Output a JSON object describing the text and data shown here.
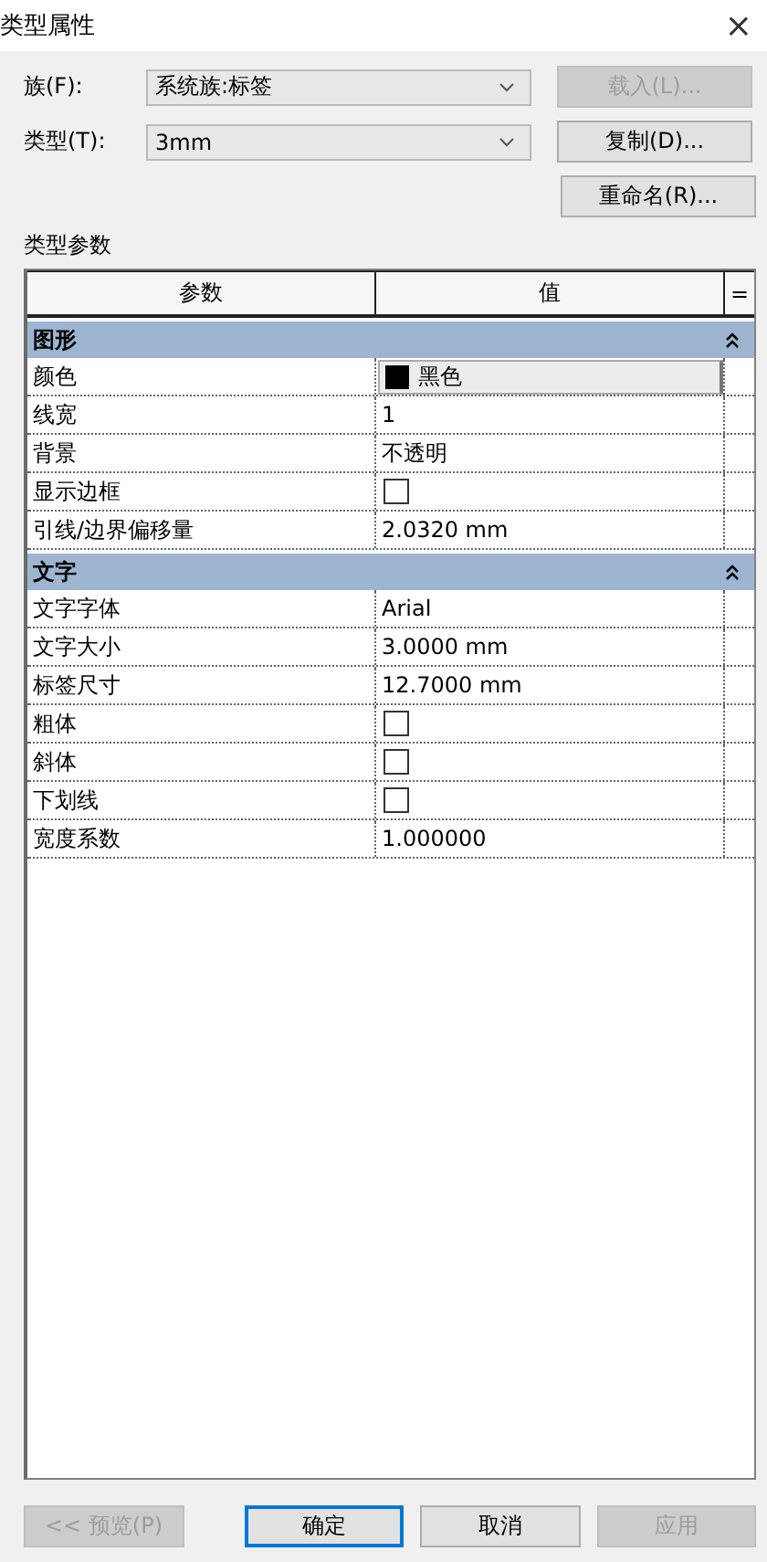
{
  "window": {
    "title": "类型属性",
    "close": "×"
  },
  "fields": [
    {
      "label": "族(F):",
      "value": "系统族:标签",
      "button": {
        "label": "载入(L)...",
        "disabled": true
      }
    },
    {
      "label": "类型(T):",
      "value": "3mm",
      "button": {
        "label": "复制(D)...",
        "disabled": false
      }
    }
  ],
  "rename_button": {
    "label": "重命名(R)...",
    "disabled": false
  },
  "section_label": "类型参数",
  "table": {
    "columns": [
      "参数",
      "值"
    ],
    "toggle": "=",
    "groups": [
      {
        "name": "图形",
        "expanded": true,
        "rows": [
          {
            "kind": "color",
            "name": "颜色",
            "value": "黑色",
            "color": "#000000"
          },
          {
            "kind": "text",
            "name": "线宽",
            "value": "1"
          },
          {
            "kind": "text",
            "name": "背景",
            "value": "不透明"
          },
          {
            "kind": "checkbox",
            "name": "显示边框",
            "checked": false
          },
          {
            "kind": "text",
            "name": "引线/边界偏移量",
            "value": "2.0320 mm"
          }
        ]
      },
      {
        "name": "文字",
        "expanded": true,
        "rows": [
          {
            "kind": "text",
            "name": "文字字体",
            "value": "Arial"
          },
          {
            "kind": "text",
            "name": "文字大小",
            "value": "3.0000 mm"
          },
          {
            "kind": "text",
            "name": "标签尺寸",
            "value": "12.7000 mm"
          },
          {
            "kind": "checkbox",
            "name": "粗体",
            "checked": false
          },
          {
            "kind": "checkbox",
            "name": "斜体",
            "checked": false
          },
          {
            "kind": "checkbox",
            "name": "下划线",
            "checked": false
          },
          {
            "kind": "text",
            "name": "宽度系数",
            "value": "1.000000"
          }
        ]
      }
    ]
  },
  "footer_buttons": [
    {
      "label": "<< 预览(P)",
      "disabled": true,
      "kind": "secondary"
    },
    {
      "label": "确定",
      "disabled": false,
      "kind": "default"
    },
    {
      "label": "取消",
      "disabled": false,
      "kind": "secondary"
    },
    {
      "label": "应用",
      "disabled": true,
      "kind": "secondary"
    }
  ]
}
